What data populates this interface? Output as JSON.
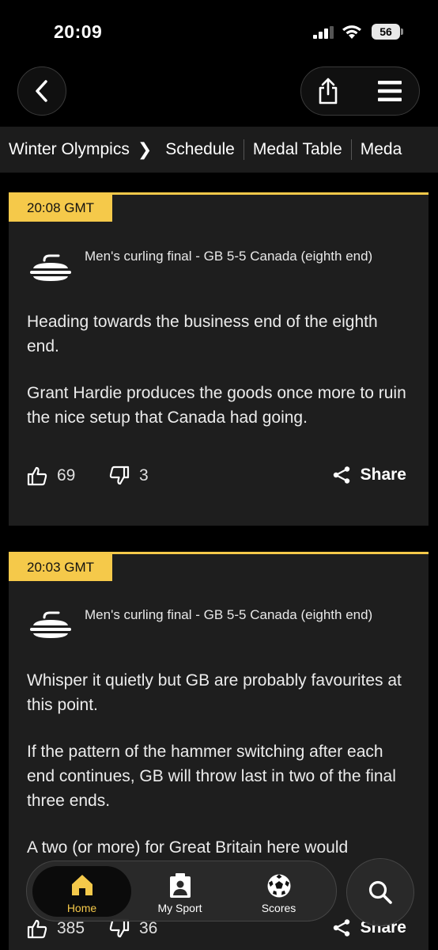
{
  "status_bar": {
    "time": "20:09",
    "battery": "56"
  },
  "breadcrumb": {
    "items": [
      "Winter Olympics",
      "Schedule",
      "Medal Table",
      "Meda"
    ]
  },
  "posts": [
    {
      "time": "20:08 GMT",
      "headline": "Men's curling final - GB 5-5 Canada (eighth end)",
      "paragraphs": [
        "Heading towards the business end of the eighth end.",
        "Grant Hardie produces the goods once more to ruin the nice setup that Canada had going."
      ],
      "likes": "69",
      "dislikes": "3",
      "share_label": "Share"
    },
    {
      "time": "20:03 GMT",
      "headline": "Men's curling final - GB 5-5 Canada (eighth end)",
      "paragraphs": [
        "Whisper it quietly but GB are probably favourites at this point.",
        "If the pattern of the hammer switching after each end continues, GB will throw last in two of the final three ends.",
        "A two (or more) for Great Britain here would"
      ],
      "likes": "385",
      "dislikes": "36",
      "share_label": "Share"
    }
  ],
  "tabbar": {
    "tabs": [
      {
        "label": "Home",
        "icon": "home-icon",
        "active": true
      },
      {
        "label": "My Sport",
        "icon": "my-sport-icon",
        "active": false
      },
      {
        "label": "Scores",
        "icon": "football-icon",
        "active": false
      }
    ]
  },
  "colors": {
    "accent": "#f5c94a",
    "background": "#000000",
    "card": "#1e1e1e",
    "nav": "#1c1c1c"
  }
}
